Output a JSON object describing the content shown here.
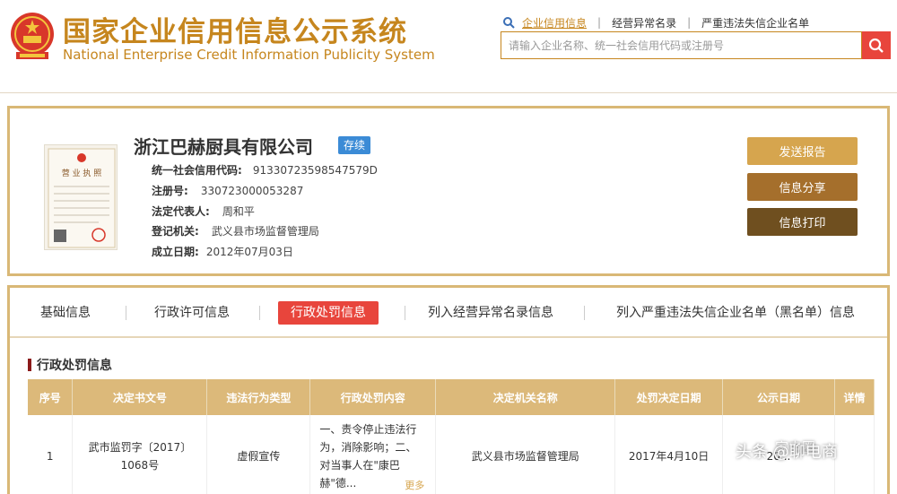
{
  "header": {
    "title_cn": "国家企业信用信息公示系统",
    "title_en": "National Enterprise Credit Information Publicity System",
    "nav": [
      "企业信用信息",
      "经营异常名录",
      "严重违法失信企业名单"
    ],
    "search_placeholder": "请输入企业名称、统一社会信用代码或注册号"
  },
  "company": {
    "name": "浙江巴赫厨具有限公司",
    "status": "存续",
    "fields": [
      {
        "label": "统一社会信用代码:",
        "value": "91330723598547579D"
      },
      {
        "label": "注册号:",
        "value": "330723000053287"
      },
      {
        "label": "法定代表人:",
        "value": "周和平"
      },
      {
        "label": "登记机关:",
        "value": "武义县市场监督管理局"
      },
      {
        "label": "成立日期:",
        "value": "2012年07月03日"
      }
    ],
    "license_title": "营 业 执 照",
    "buttons": {
      "report": "发送报告",
      "share": "信息分享",
      "print": "信息打印"
    }
  },
  "tabs": {
    "items": [
      "基础信息",
      "行政许可信息",
      "行政处罚信息",
      "列入经营异常名录信息",
      "列入严重违法失信企业名单（黑名单）信息"
    ],
    "active_index": 2
  },
  "section_title": "行政处罚信息",
  "table": {
    "headers": [
      "序号",
      "决定书文号",
      "违法行为类型",
      "行政处罚内容",
      "决定机关名称",
      "处罚决定日期",
      "公示日期",
      "详情"
    ],
    "rows": [
      {
        "no": "1",
        "doc_no": "武市监罚字〔2017〕1068号",
        "type": "虚假宣传",
        "content": "一、责令停止违法行为，消除影响；二、对当事人在\"康巴赫\"德...",
        "more": "更多",
        "authority": "武义县市场监督管理局",
        "decision_date": "2017年4月10日",
        "publish_date": "20..."
      }
    ]
  },
  "watermark": {
    "line1": "家电圈",
    "line2": "头条 @聊电商"
  },
  "colors": {
    "brand_gold": "#c6861e",
    "border_gold": "#d9b876",
    "header_bg": "#dcb97a",
    "accent_red": "#e8453c",
    "badge_blue": "#3b8bd6"
  }
}
